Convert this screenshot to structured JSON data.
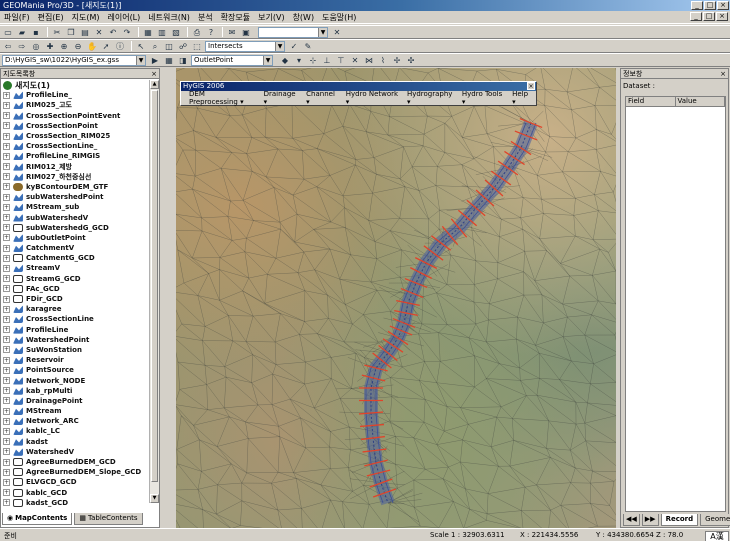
{
  "window": {
    "title": "GEOMania Pro/3D - [새지도(1)]",
    "controls": [
      "_",
      "□",
      "×"
    ]
  },
  "menu": [
    "파일(F)",
    "편집(E)",
    "지도(M)",
    "레이어(L)",
    "네트워크(N)",
    "분석",
    "확장모듈",
    "보기(V)",
    "창(W)",
    "도움말(H)"
  ],
  "toolbar": {
    "layer_select": "Intersects",
    "path_field": "D:\\HyGIS_sw\\1022\\HyGIS_ex.gss",
    "layer_combo": "OutletPoint"
  },
  "layer_panel": {
    "title": "지도목록창",
    "root": "새지도(1)",
    "layers": [
      {
        "name": "ProfileLine_",
        "type": "vec"
      },
      {
        "name": "RIM025_고도",
        "type": "vec"
      },
      {
        "name": "CrossSectionPointEvent",
        "type": "vec"
      },
      {
        "name": "CrossSectionPoint",
        "type": "vec"
      },
      {
        "name": "CrossSection_RIM025",
        "type": "vec"
      },
      {
        "name": "CrossSectionLine_",
        "type": "vec"
      },
      {
        "name": "ProfileLine_RIMGIS",
        "type": "vec"
      },
      {
        "name": "RIM012_제방",
        "type": "vec"
      },
      {
        "name": "RIM027_하천중심선",
        "type": "vec"
      },
      {
        "name": "kyBContourDEM_GTF",
        "type": "dem"
      },
      {
        "name": "subWatershedPoint",
        "type": "vec"
      },
      {
        "name": "MStream_sub",
        "type": "vec"
      },
      {
        "name": "subWatershedV",
        "type": "vec"
      },
      {
        "name": "subWatershedG_GCD",
        "type": "grid"
      },
      {
        "name": "subOutletPoint",
        "type": "vec"
      },
      {
        "name": "CatchmentV",
        "type": "vec"
      },
      {
        "name": "CatchmentG_GCD",
        "type": "grid"
      },
      {
        "name": "StreamV",
        "type": "vec"
      },
      {
        "name": "StreamG_GCD",
        "type": "grid"
      },
      {
        "name": "FAc_GCD",
        "type": "grid"
      },
      {
        "name": "FDir_GCD",
        "type": "grid"
      },
      {
        "name": "karagree",
        "type": "vec"
      },
      {
        "name": "CrossSectionLine",
        "type": "vec"
      },
      {
        "name": "ProfileLine",
        "type": "vec"
      },
      {
        "name": "WatershedPoint",
        "type": "vec"
      },
      {
        "name": "SuWonStation",
        "type": "vec"
      },
      {
        "name": "Reservoir",
        "type": "vec"
      },
      {
        "name": "PointSource",
        "type": "vec"
      },
      {
        "name": "Network_NODE",
        "type": "vec"
      },
      {
        "name": "kab_rpMulti",
        "type": "vec"
      },
      {
        "name": "DrainagePoint",
        "type": "vec"
      },
      {
        "name": "MStream",
        "type": "vec"
      },
      {
        "name": "Network_ARC",
        "type": "vec"
      },
      {
        "name": "kablc_LC",
        "type": "vec"
      },
      {
        "name": "kadst",
        "type": "vec"
      },
      {
        "name": "WatershedV",
        "type": "vec"
      },
      {
        "name": "AgreeBurnedDEM_GCD",
        "type": "grid"
      },
      {
        "name": "AgreeBurnedDEM_Slope_GCD",
        "type": "grid"
      },
      {
        "name": "ELVGCD_GCD",
        "type": "grid"
      },
      {
        "name": "kablc_GCD",
        "type": "grid"
      },
      {
        "name": "kadst_GCD",
        "type": "grid"
      }
    ],
    "tabs": [
      "MapContents",
      "TableContents"
    ]
  },
  "hygis": {
    "title": "HyGIS 2006",
    "menu": [
      "DEM Preprocessing ▾",
      "Drainage ▾",
      "Channel ▾",
      "Hydro Network ▾",
      "Hydrography ▾",
      "Hydro Tools ▾",
      "Help ▾"
    ]
  },
  "info_panel": {
    "title": "정보창",
    "dataset_label": "Dataset :",
    "columns": [
      "Field",
      "Value"
    ],
    "tabs": [
      "Record",
      "Geome"
    ]
  },
  "status": {
    "left": "준비",
    "scale": "Scale 1 : 32903.6311",
    "x": "X : 221434.5556",
    "y": "Y : 434380.6654",
    "z": "Z :  78.0",
    "ime": "A漢"
  }
}
